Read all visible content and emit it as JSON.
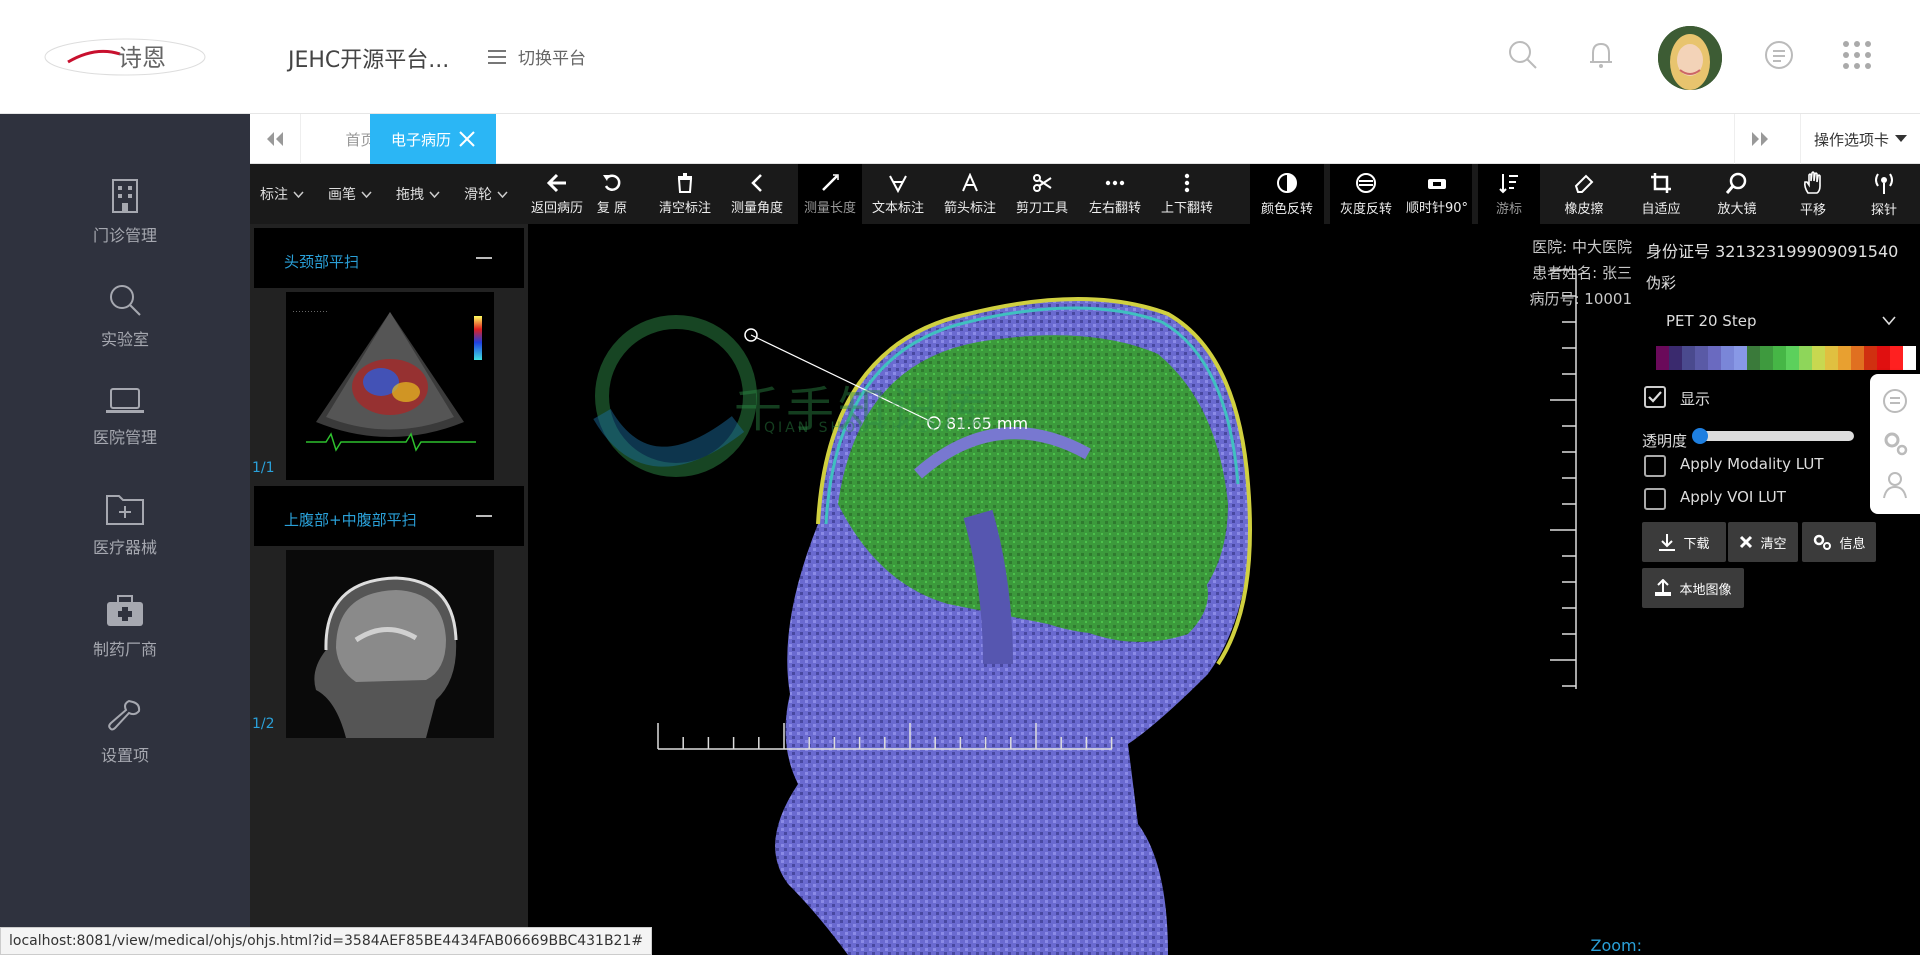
{
  "header": {
    "logo_text": "诗恩",
    "app_title": "JEHC开源平台...",
    "switch_label": "切换平台",
    "icons": [
      "search-icon",
      "bell-icon",
      "avatar",
      "chat-icon",
      "apps-grid-icon"
    ]
  },
  "sidebar": {
    "items": [
      {
        "label": "门诊管理",
        "icon": "building-icon"
      },
      {
        "label": "实验室",
        "icon": "search-icon"
      },
      {
        "label": "医院管理",
        "icon": "laptop-icon"
      },
      {
        "label": "医疗器械",
        "icon": "folder-plus-icon"
      },
      {
        "label": "制药厂商",
        "icon": "medkit-icon"
      },
      {
        "label": "设置项",
        "icon": "wrench-icon"
      }
    ]
  },
  "tabs": {
    "home": "首页",
    "active": "电子病历",
    "options": "操作选项卡"
  },
  "toolbar": {
    "selects": [
      "标注",
      "画笔",
      "拖拽",
      "滑轮"
    ],
    "tools": [
      {
        "label": "返回病历",
        "icon": "arrow-left-icon"
      },
      {
        "label": "复 原",
        "icon": "undo-icon"
      },
      {
        "label": "清空标注",
        "icon": "trash-icon"
      },
      {
        "label": "测量角度",
        "icon": "angle-icon"
      },
      {
        "label": "测量长度",
        "icon": "ruler-icon"
      },
      {
        "label": "文本标注",
        "icon": "text-annotate-icon"
      },
      {
        "label": "箭头标注",
        "icon": "arrow-annotate-icon"
      },
      {
        "label": "剪刀工具",
        "icon": "scissors-icon"
      },
      {
        "label": "左右翻转",
        "icon": "flip-horizontal-icon"
      },
      {
        "label": "上下翻转",
        "icon": "flip-vertical-icon"
      },
      {
        "label": "颜色反转",
        "icon": "invert-icon"
      },
      {
        "label": "灰度反转",
        "icon": "grayscale-icon"
      },
      {
        "label": "顺时针90°",
        "icon": "rotate-icon"
      },
      {
        "label": "游标",
        "icon": "cursor-icon"
      },
      {
        "label": "橡皮擦",
        "icon": "eraser-icon"
      },
      {
        "label": "自适应",
        "icon": "crop-icon"
      },
      {
        "label": "放大镜",
        "icon": "magnifier-icon"
      },
      {
        "label": "平移",
        "icon": "hand-icon"
      },
      {
        "label": "探针",
        "icon": "probe-icon"
      }
    ]
  },
  "series": [
    {
      "title": "头颈部平扫",
      "page": "1/1"
    },
    {
      "title": "上腹部+中腹部平扫",
      "page": "1/2"
    }
  ],
  "viewer": {
    "hospital": "医院: 中大医院",
    "patient": "患者姓名: 张三",
    "record": "病历号: 10001",
    "measurement": "81.65 mm",
    "zoom": "Zoom:",
    "watermark": "千手知识库",
    "watermark_sub": "QIAN SHOU ZHI SHI KU"
  },
  "panel": {
    "idcard": "身份证号 321323199909091540",
    "pseudocolor": "伪彩",
    "lut": "PET 20 Step",
    "show": "显示",
    "show_checked": true,
    "opacity": "透明度",
    "opacity_value": 0,
    "modality_lut": "Apply Modality LUT",
    "voi_lut": "Apply VOI LUT",
    "download": "下载",
    "clear": "清空",
    "info": "信息",
    "local_image": "本地图像",
    "colors": [
      "#6a0a5a",
      "#3a2a6e",
      "#4a4a8e",
      "#5a5aa6",
      "#6a6ac0",
      "#7a86d8",
      "#8898e6",
      "#3a7a3a",
      "#3e9a3e",
      "#46b646",
      "#5cd05c",
      "#8ed65a",
      "#c8d850",
      "#e0c040",
      "#e8a030",
      "#e07020",
      "#d03010",
      "#e01010",
      "#ff2020",
      "#ffffff"
    ]
  },
  "status_url": "localhost:8081/view/medical/ohjs/ohjs.html?id=3584AEF85BE4434FAB06669BBC431B21#"
}
